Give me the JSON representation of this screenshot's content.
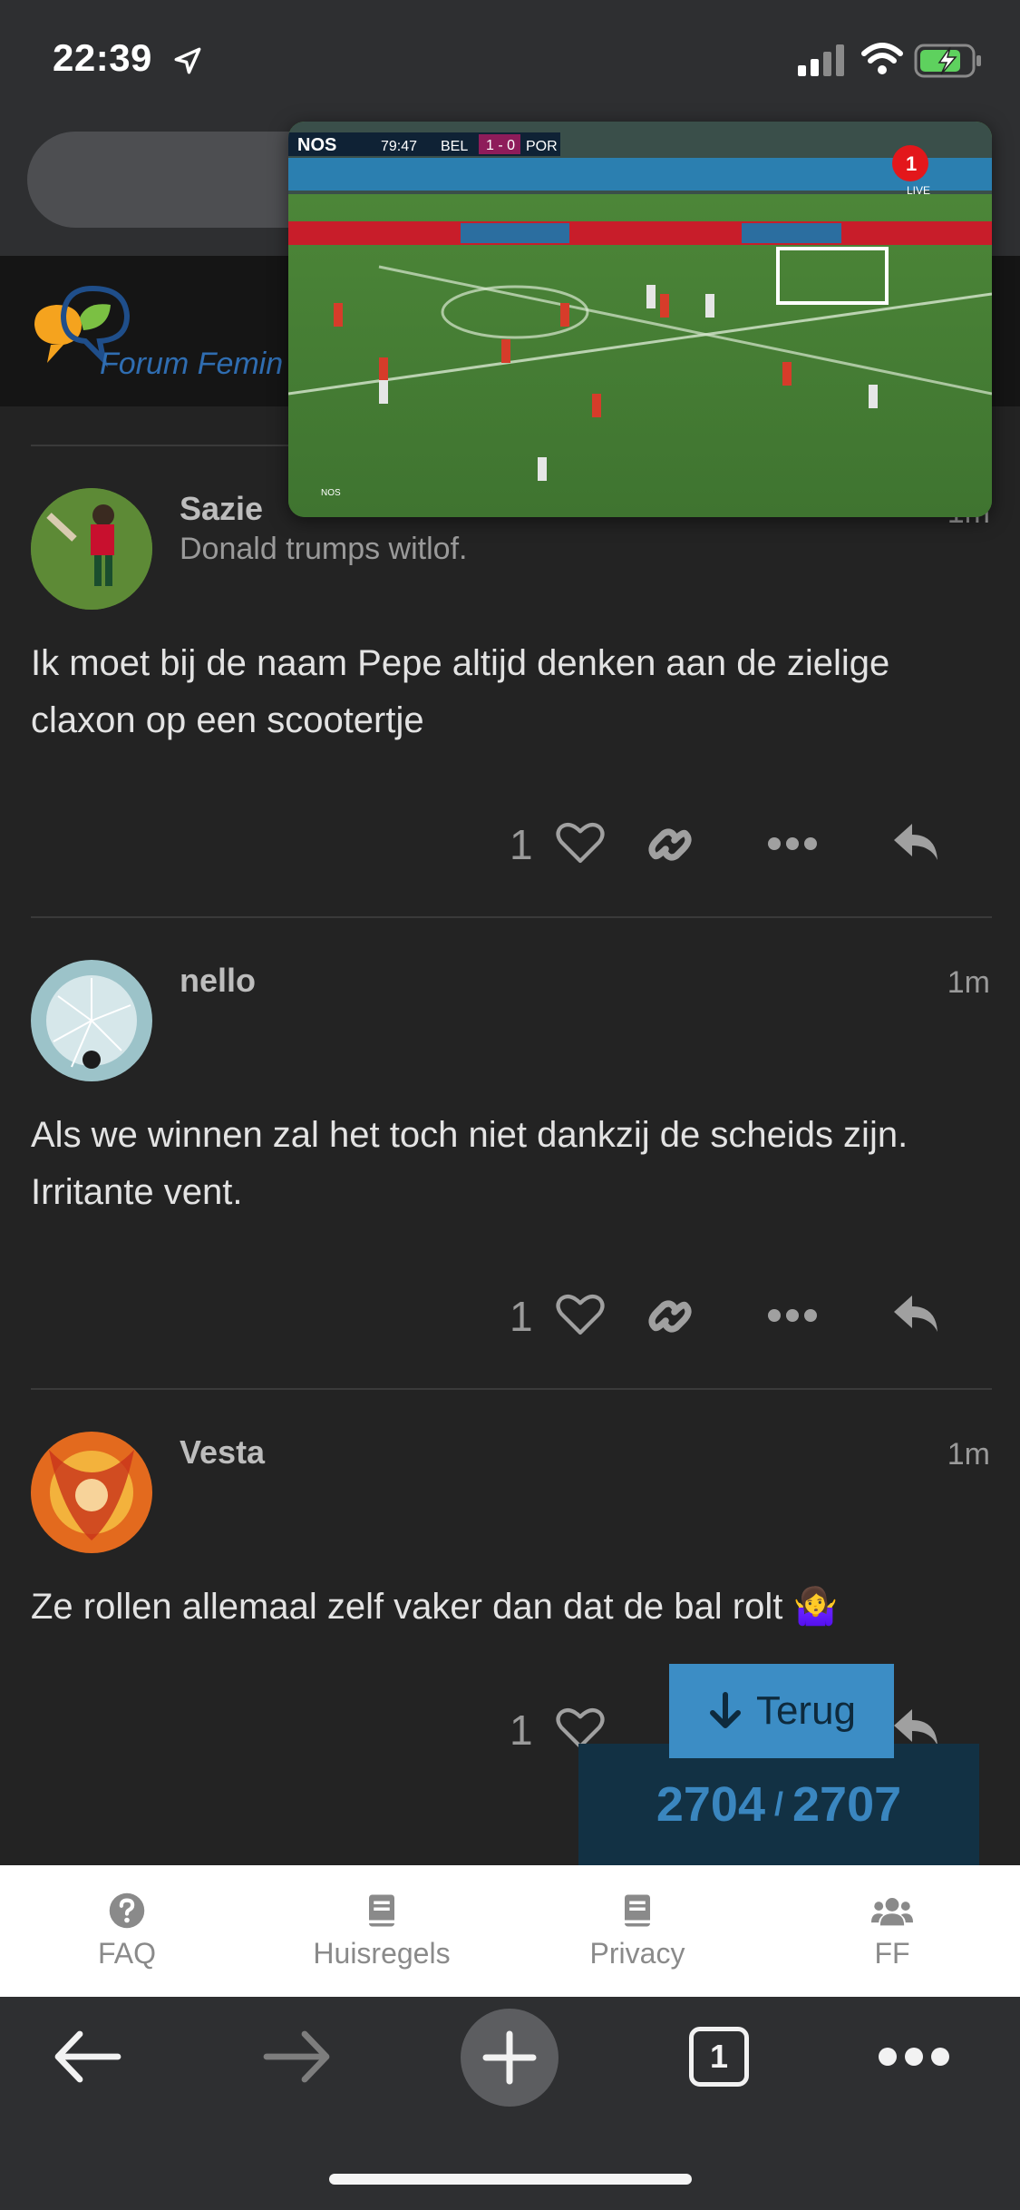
{
  "status_bar": {
    "time": "22:39"
  },
  "forum": {
    "logo_text": "Forum Femin"
  },
  "pip": {
    "broadcaster": "NOS",
    "clock": "79:47",
    "home_team": "BEL",
    "score": "1 - 0",
    "away_team": "POR",
    "badge": "1",
    "live_label": "LIVE",
    "watermark": "NOS"
  },
  "posts": [
    {
      "username": "Sazie",
      "user_title": "Donald trumps witlof.",
      "time": "1m",
      "text": "Ik moet bij de naam Pepe altijd denken aan de zielige claxon op een scootertje",
      "likes": "1"
    },
    {
      "username": "nello",
      "user_title": "",
      "time": "1m",
      "text": "Als we winnen zal het toch niet dankzij de scheids zijn. Irritante vent.",
      "likes": "1"
    },
    {
      "username": "Vesta",
      "user_title": "",
      "time": "1m",
      "text": "Ze rollen allemaal zelf vaker dan dat de bal rolt 🤷‍♀️",
      "likes": "1"
    }
  ],
  "floating": {
    "back_label": "Terug",
    "current": "2704",
    "separator": "/",
    "total": "2707"
  },
  "footer_nav": [
    {
      "label": "FAQ",
      "icon": "question-icon"
    },
    {
      "label": "Huisregels",
      "icon": "book-icon"
    },
    {
      "label": "Privacy",
      "icon": "book-icon"
    },
    {
      "label": "FF",
      "icon": "users-icon"
    }
  ],
  "toolbar": {
    "tabs_count": "1"
  },
  "colors": {
    "accent": "#3c8dc5",
    "background": "#232323",
    "counter_bg": "#123144"
  }
}
